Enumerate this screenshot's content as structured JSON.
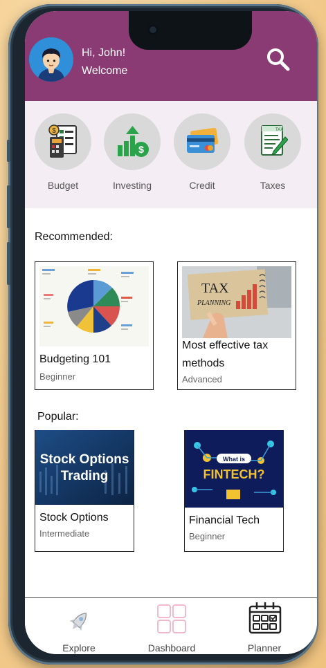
{
  "header": {
    "greeting": "Hi, John!",
    "welcome": "Welcome",
    "avatar_icon": "user-avatar-icon",
    "search_icon": "search-icon",
    "bg_color": "#8b3b74"
  },
  "categories": [
    {
      "label": "Budget",
      "icon": "budget-calculator-icon"
    },
    {
      "label": "Investing",
      "icon": "investing-growth-icon"
    },
    {
      "label": "Credit",
      "icon": "credit-card-icon"
    },
    {
      "label": "Taxes",
      "icon": "tax-form-icon"
    }
  ],
  "recommended": {
    "title": "Recommended:",
    "items": [
      {
        "title": "Budgeting 101",
        "level": "Beginner"
      },
      {
        "title": "Most effective tax methods",
        "level": "Advanced"
      }
    ]
  },
  "popular": {
    "title": "Popular:",
    "items": [
      {
        "title": "Stock Options",
        "level": "Intermediate",
        "thumb_text_1": "Stock Options",
        "thumb_text_2": "Trading"
      },
      {
        "title": "Financial Tech",
        "level": "Beginner",
        "thumb_text_1": "What is",
        "thumb_text_2": "FINTECH?"
      }
    ]
  },
  "thumb_texts": {
    "tax_1": "TAX",
    "tax_2": "PLANNING"
  },
  "nav": [
    {
      "label": "Explore",
      "icon": "rocket-icon"
    },
    {
      "label": "Dashboard",
      "icon": "dashboard-grid-icon"
    },
    {
      "label": "Planner",
      "icon": "calendar-icon"
    }
  ]
}
